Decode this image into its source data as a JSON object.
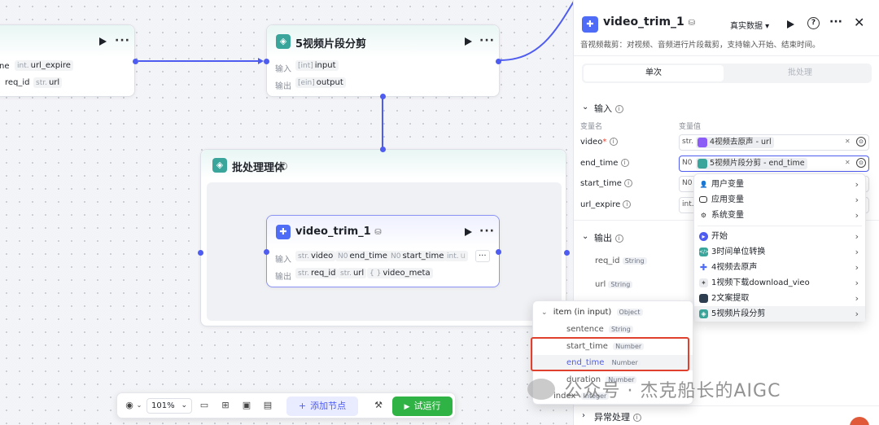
{
  "canvas": {
    "left_node": {
      "ports_row1": [
        {
          "type": "int.",
          "name": "url_expire"
        }
      ],
      "ports_row1_prefix": "ne",
      "ports_row2": [
        {
          "type": "",
          "name": "req_id"
        },
        {
          "type": "str.",
          "name": "url"
        }
      ]
    },
    "split_node": {
      "title": "5视频片段分剪",
      "input_label": "输入",
      "output_label": "输出",
      "input_type": "[int]",
      "input_name": "input",
      "output_type": "[ein]",
      "output_name": "output"
    },
    "batch_node": {
      "title": "批处理理体",
      "info_icon": "info-icon"
    },
    "trim_node": {
      "title": "video_trim_1",
      "input_label": "输入",
      "output_label": "输出",
      "inputs": [
        {
          "type": "str.",
          "name": "video"
        },
        {
          "type": "N0",
          "name": "end_time"
        },
        {
          "type": "N0",
          "name": "start_time"
        },
        {
          "type": "int.",
          "name": "u"
        }
      ],
      "outputs": [
        {
          "type": "str.",
          "name": "req_id"
        },
        {
          "type": "str.",
          "name": "url"
        },
        {
          "type": "{ }",
          "name": "video_meta"
        }
      ]
    }
  },
  "panel": {
    "title": "video_trim_1",
    "data_mode": "真实数据",
    "description": "音视频裁剪：对视频、音频进行片段裁剪，支持输入开始、结束时间。",
    "tabs": [
      {
        "label": "单次",
        "active": true
      },
      {
        "label": "批处理",
        "active": false
      }
    ],
    "input_section": "输入",
    "col_var_name": "变量名",
    "col_var_value": "变量值",
    "inputs": [
      {
        "name": "video",
        "required": "*",
        "type": "str.",
        "value": "4视频去原声 - url",
        "chip_color": "#8b5cf6"
      },
      {
        "name": "end_time",
        "required": "",
        "type": "N0",
        "value": "5视频片段分剪 - end_time",
        "chip_color": "#3aa59a"
      },
      {
        "name": "start_time",
        "required": "",
        "type": "N0",
        "value": "",
        "chip_color": ""
      },
      {
        "name": "url_expire",
        "required": "",
        "type": "int.",
        "value": "",
        "chip_color": ""
      }
    ],
    "output_section": "输出",
    "outputs": [
      {
        "name": "req_id",
        "type": "String"
      },
      {
        "name": "url",
        "type": "String"
      }
    ],
    "exception_section": "异常处理"
  },
  "menu": {
    "items": [
      {
        "label": "用户变量",
        "icon": "user-icon",
        "glyph": "👤",
        "color": "#ffffff"
      },
      {
        "label": "应用变量",
        "icon": "folder-icon",
        "glyph": "▭",
        "color": "#ffffff"
      },
      {
        "label": "系统变量",
        "icon": "gear-icon",
        "glyph": "⚙",
        "color": "#ffffff"
      },
      {
        "label": "开始",
        "icon": "start-icon",
        "glyph": "▶",
        "color": "#4f5cf0"
      },
      {
        "label": "3时间单位转换",
        "icon": "code-icon",
        "glyph": "<>",
        "color": "#3aa59a"
      },
      {
        "label": "4视频去原声",
        "icon": "plugin-icon",
        "glyph": "✚",
        "color": "#4f6cf6"
      },
      {
        "label": "1视频下载download_vieo",
        "icon": "plugin-icon",
        "glyph": "✦",
        "color": "#9aa0aa"
      },
      {
        "label": "2文案提取",
        "icon": "plugin-icon",
        "glyph": "■",
        "color": "#2c3e50"
      },
      {
        "label": "5视频片段分剪",
        "icon": "batch-icon",
        "glyph": "◈",
        "color": "#3aa59a"
      }
    ]
  },
  "submenu": {
    "group_label": "item (in input)",
    "group_type": "Object",
    "items": [
      {
        "name": "sentence",
        "type": "String"
      },
      {
        "name": "start_time",
        "type": "Number"
      },
      {
        "name": "end_time",
        "type": "Number"
      },
      {
        "name": "duration",
        "type": "Number"
      },
      {
        "name": "index",
        "type": "Integer"
      }
    ]
  },
  "toolbar": {
    "zoom": "101%",
    "add_node": "添加节点",
    "run": "试运行"
  },
  "watermark": "公众号 · 杰克船长的AIGC",
  "colors": {
    "accent": "#4f5cf0",
    "teal": "#3aa59a",
    "run_green": "#2fb344",
    "highlight": "#e0412f"
  }
}
